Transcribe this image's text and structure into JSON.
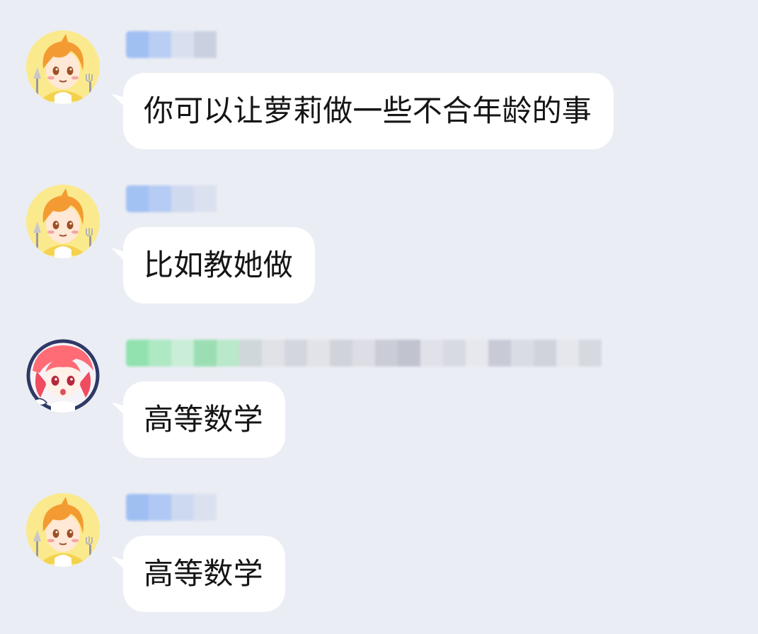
{
  "colors": {
    "background": "#eaedf4",
    "bubble": "#ffffff",
    "text": "#151515",
    "blue_nameplate": "#9dbdf2",
    "green_nameplate": "#7ddca0",
    "boy_avatar_bg": "#fbe98d",
    "girl_avatar_bg": "#f5f3f8"
  },
  "messages": [
    {
      "avatar_icon": "orange-haired-boy-avatar-icon",
      "sender_visible": false,
      "sender_badge_color": "blue",
      "text": "你可以让萝莉做一些不合年龄的事"
    },
    {
      "avatar_icon": "orange-haired-boy-avatar-icon",
      "sender_visible": false,
      "sender_badge_color": "blue",
      "text": "比如教她做"
    },
    {
      "avatar_icon": "red-haired-girl-avatar-icon",
      "sender_visible": false,
      "sender_badge_color": "green",
      "text": "高等数学"
    },
    {
      "avatar_icon": "orange-haired-boy-avatar-icon",
      "sender_visible": false,
      "sender_badge_color": "blue",
      "text": "高等数学"
    }
  ]
}
